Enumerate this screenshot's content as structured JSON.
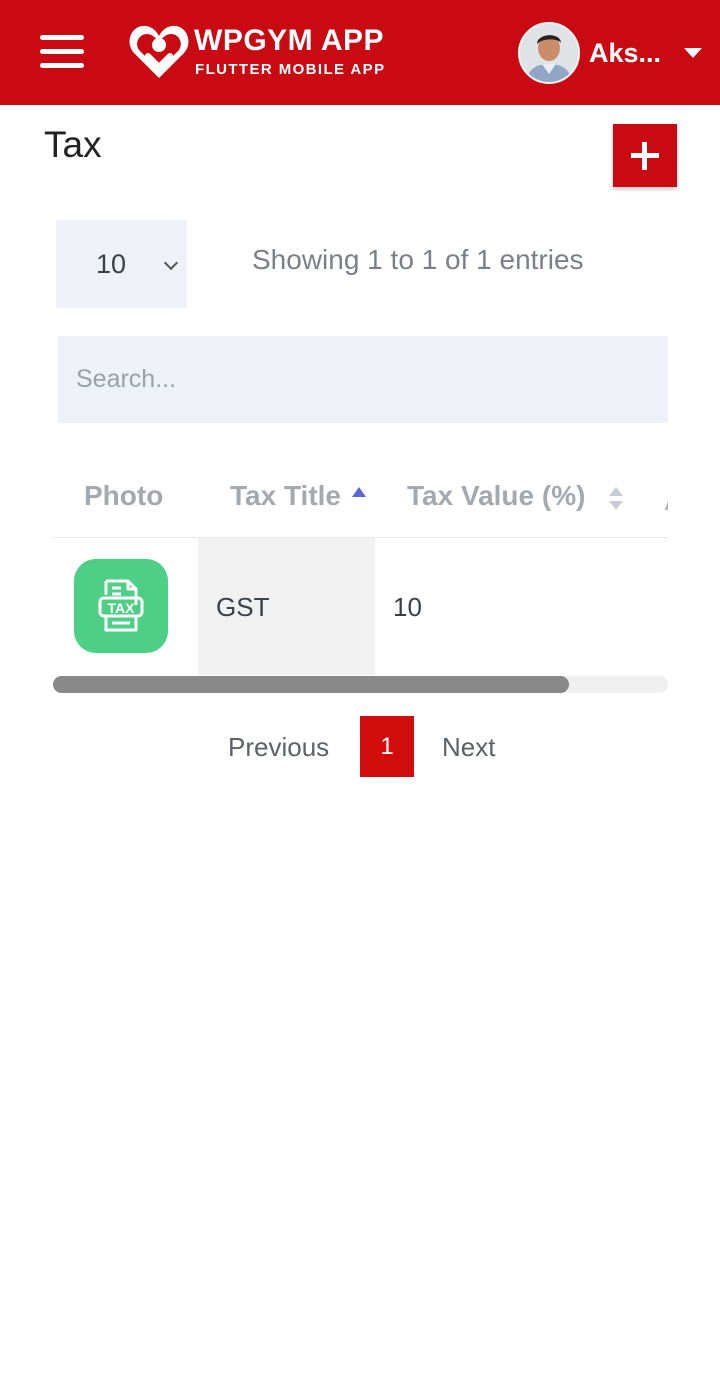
{
  "header": {
    "app_title": "WPGYM APP",
    "app_subtitle": "FLUTTER MOBILE APP",
    "user_name": "Aks...",
    "icons": [
      "menu-icon",
      "logo-icon",
      "avatar",
      "caret-down-icon"
    ],
    "brand_color": "#c90a12"
  },
  "page": {
    "title": "Tax",
    "add_icon": "plus-icon"
  },
  "controls": {
    "page_size": "10",
    "info": "Showing 1 to 1 of 1 entries",
    "search_placeholder": "Search..."
  },
  "table": {
    "columns": [
      "Photo",
      "Tax Title",
      "Tax Value (%)"
    ],
    "rows": [
      {
        "photo_icon": "tax-document-icon",
        "photo_label": "TAX",
        "title": "GST",
        "value": "10"
      }
    ]
  },
  "pagination": {
    "previous": "Previous",
    "current": "1",
    "next": "Next"
  }
}
